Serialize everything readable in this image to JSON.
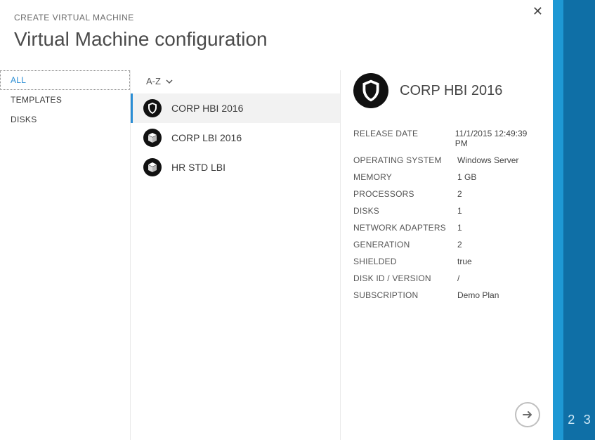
{
  "header": {
    "breadcrumb": "CREATE VIRTUAL MACHINE",
    "title": "Virtual Machine configuration"
  },
  "sidebar": {
    "items": [
      {
        "label": "ALL",
        "selected": true
      },
      {
        "label": "TEMPLATES",
        "selected": false
      },
      {
        "label": "DISKS",
        "selected": false
      }
    ]
  },
  "sort": {
    "label": "A-Z"
  },
  "templates": [
    {
      "icon": "shield",
      "label": "CORP HBI 2016",
      "selected": true
    },
    {
      "icon": "cube",
      "label": "CORP LBI 2016",
      "selected": false
    },
    {
      "icon": "cube",
      "label": "HR STD LBI",
      "selected": false
    }
  ],
  "detail": {
    "icon": "shield",
    "title": "CORP HBI 2016",
    "props": [
      {
        "label": "RELEASE DATE",
        "value": "11/1/2015 12:49:39 PM"
      },
      {
        "label": "OPERATING SYSTEM",
        "value": "Windows Server"
      },
      {
        "label": "MEMORY",
        "value": "1 GB"
      },
      {
        "label": "PROCESSORS",
        "value": "2"
      },
      {
        "label": "DISKS",
        "value": "1"
      },
      {
        "label": "NETWORK ADAPTERS",
        "value": "1"
      },
      {
        "label": "GENERATION",
        "value": "2"
      },
      {
        "label": "SHIELDED",
        "value": "true"
      },
      {
        "label": "DISK ID / VERSION",
        "value": "/"
      },
      {
        "label": "SUBSCRIPTION",
        "value": "Demo Plan"
      }
    ]
  },
  "steps": {
    "numbers": [
      "2",
      "3"
    ]
  }
}
